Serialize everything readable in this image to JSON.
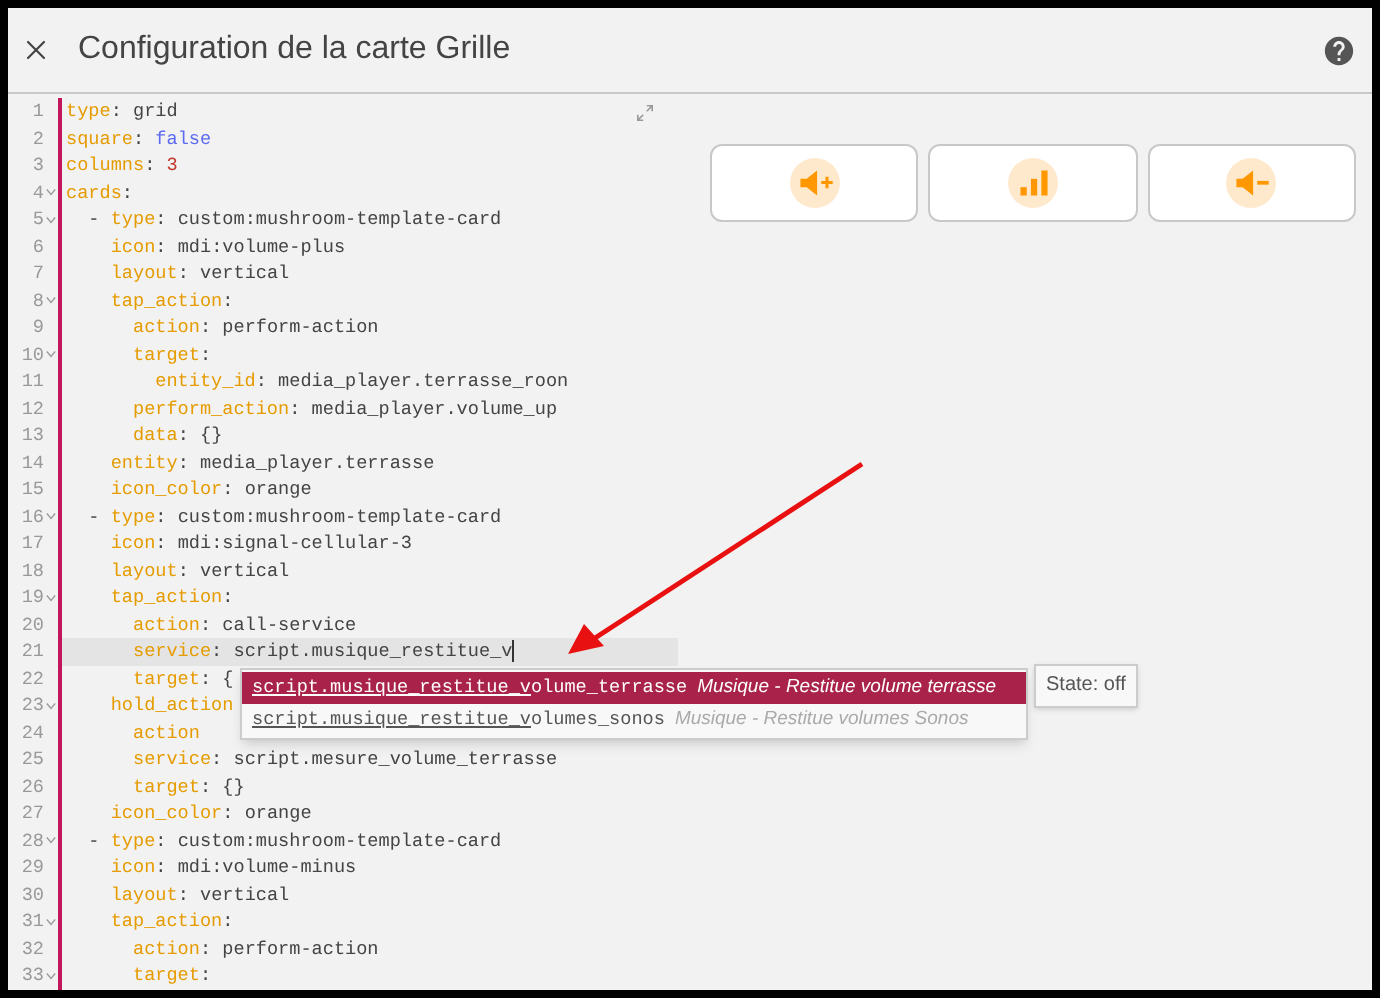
{
  "dialog": {
    "title": "Configuration de la carte Grille"
  },
  "editor": {
    "lines": [
      {
        "number": "1",
        "foldable": false,
        "key": "type",
        "sep": ":",
        "value": "grid"
      },
      {
        "number": "2",
        "foldable": false,
        "key": "square",
        "sep": ":",
        "value": "false",
        "kind": "boolean"
      },
      {
        "number": "3",
        "foldable": false,
        "key": "columns",
        "sep": ":",
        "value": "3",
        "kind": "number"
      },
      {
        "number": "4",
        "foldable": true,
        "key": "cards",
        "sep": ":",
        "children": [
          {
            "number": "5",
            "foldable": true,
            "dash": "-",
            "key": "type",
            "sep": ":",
            "value": "custom:mushroom-template-card",
            "children": [
              {
                "number": "6",
                "foldable": false,
                "key": "icon",
                "sep": ":",
                "value": "mdi:volume-plus"
              },
              {
                "number": "7",
                "foldable": false,
                "key": "layout",
                "sep": ":",
                "value": "vertical"
              },
              {
                "number": "8",
                "foldable": true,
                "key": "tap_action",
                "sep": ":",
                "children": [
                  {
                    "number": "9",
                    "foldable": false,
                    "key": "action",
                    "sep": ":",
                    "value": "perform-action"
                  },
                  {
                    "number": "10",
                    "foldable": true,
                    "key": "target",
                    "sep": ":",
                    "children": [
                      {
                        "number": "11",
                        "foldable": false,
                        "key": "entity_id",
                        "sep": ":",
                        "value": "media_player.terrasse_roon"
                      }
                    ]
                  },
                  {
                    "number": "12",
                    "foldable": false,
                    "key": "perform_action",
                    "sep": ":",
                    "value": "media_player.volume_up"
                  },
                  {
                    "number": "13",
                    "foldable": false,
                    "key": "data",
                    "sep": ":",
                    "value": "{}"
                  }
                ]
              },
              {
                "number": "14",
                "foldable": false,
                "key": "entity",
                "sep": ":",
                "value": "media_player.terrasse"
              },
              {
                "number": "15",
                "foldable": false,
                "key": "icon_color",
                "sep": ":",
                "value": "orange"
              }
            ]
          },
          {
            "number": "16",
            "foldable": true,
            "dash": "-",
            "key": "type",
            "sep": ":",
            "value": "custom:mushroom-template-card",
            "children": [
              {
                "number": "17",
                "foldable": false,
                "key": "icon",
                "sep": ":",
                "value": "mdi:signal-cellular-3"
              },
              {
                "number": "18",
                "foldable": false,
                "key": "layout",
                "sep": ":",
                "value": "vertical"
              },
              {
                "number": "19",
                "foldable": true,
                "key": "tap_action",
                "sep": ":",
                "children": [
                  {
                    "number": "20",
                    "foldable": false,
                    "key": "action",
                    "sep": ":",
                    "value": "call-service"
                  },
                  {
                    "number": "21",
                    "foldable": false,
                    "key": "service",
                    "sep": ":",
                    "value": "script.musique_restitue_v",
                    "current": true
                  },
                  {
                    "number": "22",
                    "foldable": false,
                    "key": "target",
                    "sep": ":",
                    "value": "{"
                  }
                ]
              },
              {
                "number": "23",
                "foldable": true,
                "key": "hold_action",
                "children": [
                  {
                    "number": "24",
                    "foldable": false,
                    "key": "action"
                  },
                  {
                    "number": "25",
                    "foldable": false,
                    "key": "service",
                    "sep": ":",
                    "value": "script.mesure_volume_terrasse"
                  },
                  {
                    "number": "26",
                    "foldable": false,
                    "key": "target",
                    "sep": ":",
                    "value": "{}"
                  }
                ]
              },
              {
                "number": "27",
                "foldable": false,
                "key": "icon_color",
                "sep": ":",
                "value": "orange"
              }
            ]
          },
          {
            "number": "28",
            "foldable": true,
            "dash": "-",
            "key": "type",
            "sep": ":",
            "value": "custom:mushroom-template-card",
            "children": [
              {
                "number": "29",
                "foldable": false,
                "key": "icon",
                "sep": ":",
                "value": "mdi:volume-minus"
              },
              {
                "number": "30",
                "foldable": false,
                "key": "layout",
                "sep": ":",
                "value": "vertical"
              },
              {
                "number": "31",
                "foldable": true,
                "key": "tap_action",
                "sep": ":",
                "children": [
                  {
                    "number": "32",
                    "foldable": false,
                    "key": "action",
                    "sep": ":",
                    "value": "perform-action"
                  },
                  {
                    "number": "33",
                    "foldable": true,
                    "key": "target",
                    "sep": ":"
                  }
                ]
              }
            ]
          }
        ]
      }
    ],
    "autocomplete": [
      {
        "match": "script.musique_restitue_v",
        "rest": "olume_terrasse",
        "description": "Musique - Restitue volume terrasse",
        "selected": true
      },
      {
        "match": "script.musique_restitue_v",
        "rest": "olumes_sonos",
        "description": "Musique - Restitue volumes Sonos",
        "selected": false
      }
    ],
    "tooltip": "State: off"
  },
  "preview": {
    "cards": [
      {
        "kind": "volume-plus"
      },
      {
        "kind": "signal"
      },
      {
        "kind": "volume-minus"
      }
    ]
  }
}
